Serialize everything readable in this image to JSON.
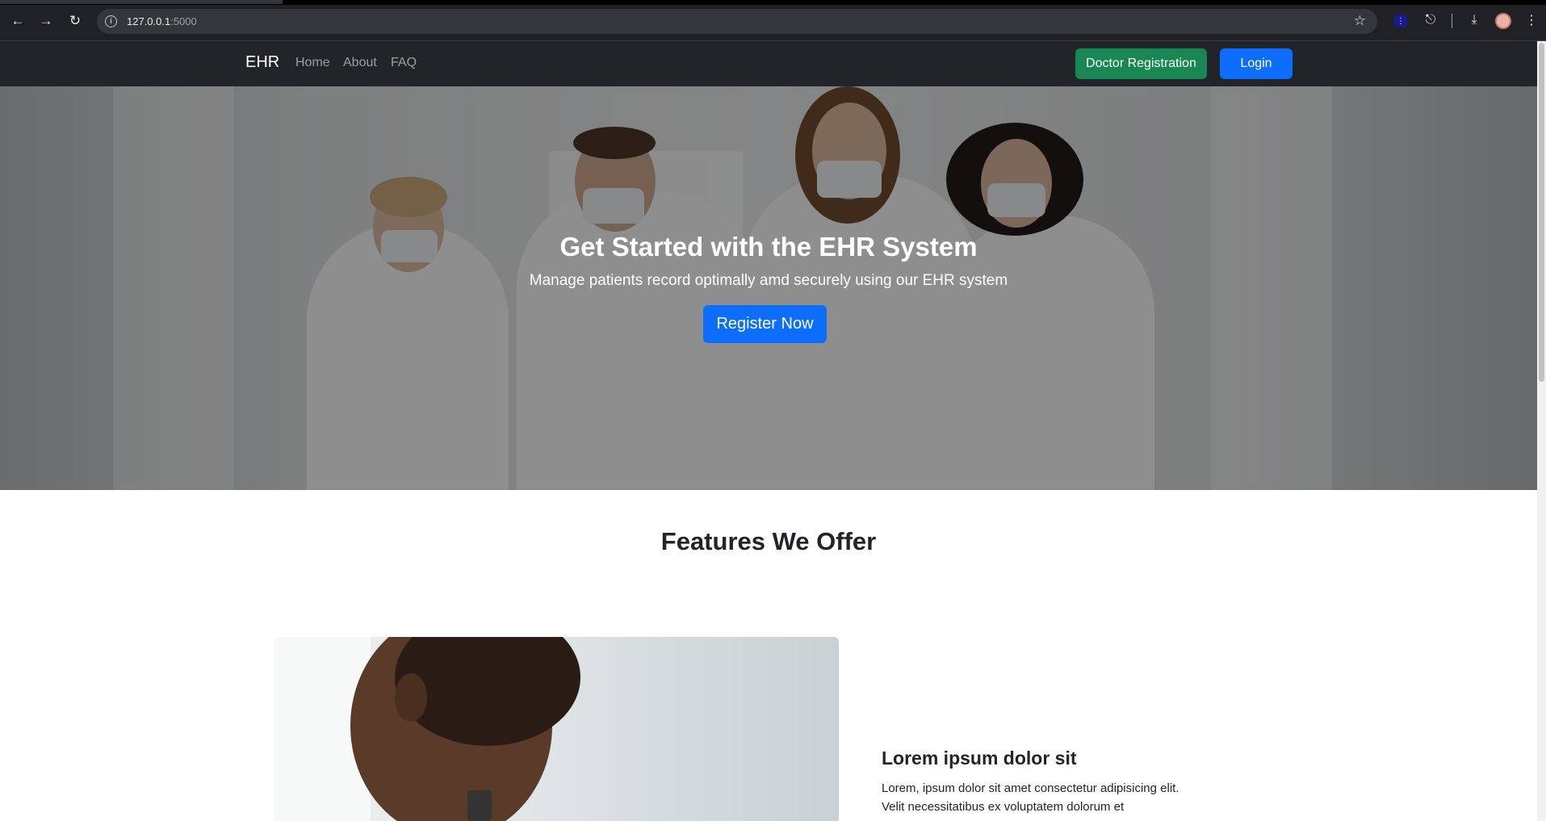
{
  "browser": {
    "url_host": "127.0.0.1",
    "url_port": ":5000"
  },
  "navbar": {
    "brand": "EHR",
    "links": [
      "Home",
      "About",
      "FAQ"
    ],
    "doctor_registration": "Doctor Registration",
    "login": "Login"
  },
  "hero": {
    "title": "Get Started with the EHR System",
    "subtitle": "Manage patients record optimally amd securely using our EHR system",
    "cta": "Register Now"
  },
  "features": {
    "title": "Features We Offer",
    "items": [
      {
        "heading": "Lorem ipsum dolor sit",
        "text": "Lorem, ipsum dolor sit amet consectetur adipisicing elit. Velit necessitatibus ex voluptatem dolorum et"
      }
    ]
  },
  "colors": {
    "navbar_bg": "#212529",
    "primary": "#0d6efd",
    "success": "#198754"
  },
  "icons": [
    "back-arrow-icon",
    "forward-arrow-icon",
    "reload-icon",
    "info-icon",
    "star-icon",
    "extension-icon",
    "download-icon",
    "menu-dots-icon"
  ]
}
